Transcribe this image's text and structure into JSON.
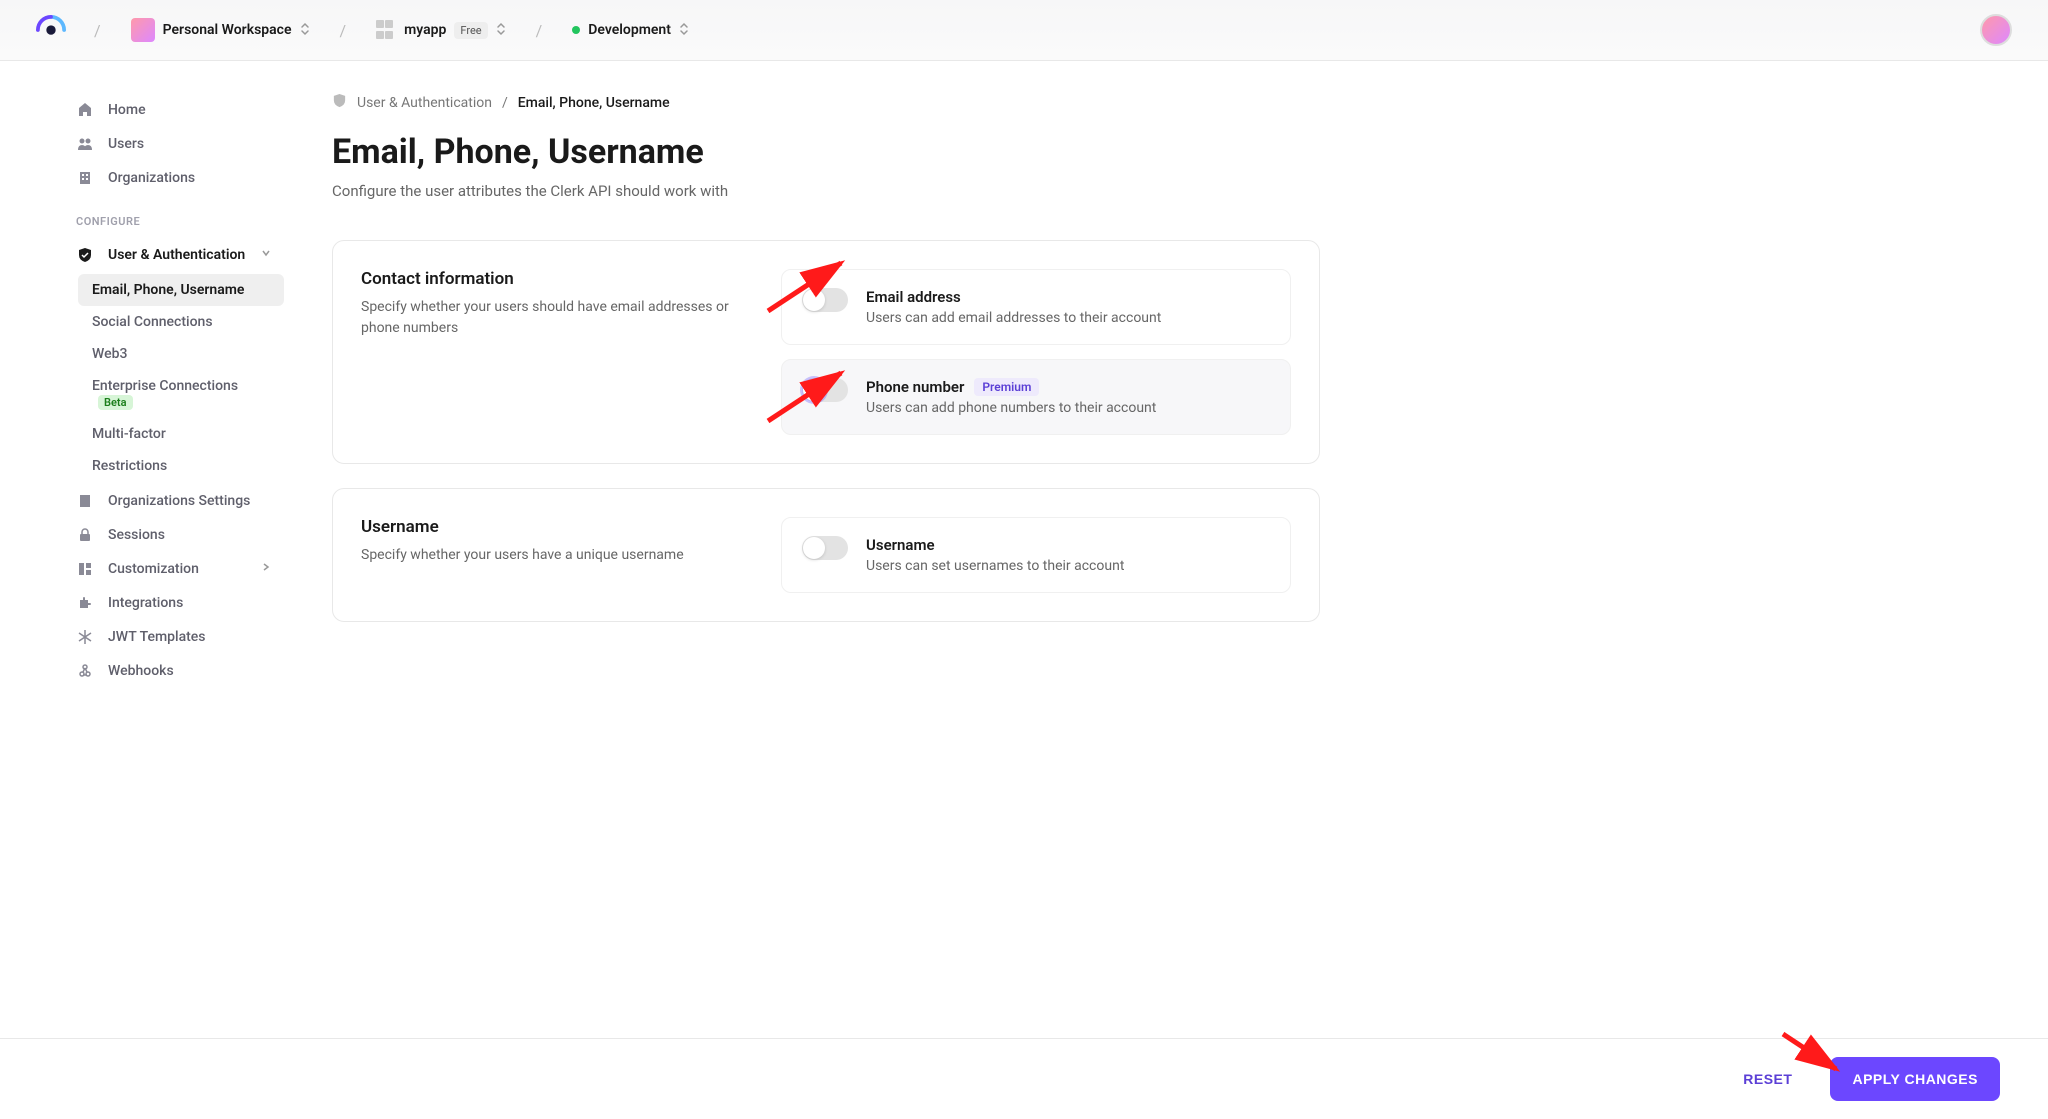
{
  "header": {
    "workspace": "Personal Workspace",
    "app": "myapp",
    "app_badge": "Free",
    "env": "Development"
  },
  "sidebar": {
    "top": [
      {
        "label": "Home"
      },
      {
        "label": "Users"
      },
      {
        "label": "Organizations"
      }
    ],
    "configure_label": "CONFIGURE",
    "ua_label": "User & Authentication",
    "ua_sub": [
      {
        "label": "Email, Phone, Username"
      },
      {
        "label": "Social Connections"
      },
      {
        "label": "Web3"
      },
      {
        "label": "Enterprise Connections",
        "badge": "Beta"
      },
      {
        "label": "Multi-factor"
      },
      {
        "label": "Restrictions"
      }
    ],
    "rest": [
      {
        "label": "Organizations Settings"
      },
      {
        "label": "Sessions"
      },
      {
        "label": "Customization",
        "chevron": true
      },
      {
        "label": "Integrations"
      },
      {
        "label": "JWT Templates"
      },
      {
        "label": "Webhooks"
      }
    ]
  },
  "breadcrumb": {
    "parent": "User & Authentication",
    "current": "Email, Phone, Username"
  },
  "page": {
    "title": "Email, Phone, Username",
    "subtitle": "Configure the user attributes the Clerk API should work with"
  },
  "sections": {
    "contact": {
      "title": "Contact information",
      "desc": "Specify whether your users should have email addresses or phone numbers",
      "options": [
        {
          "title": "Email address",
          "desc": "Users can add email addresses to their account"
        },
        {
          "title": "Phone number",
          "desc": "Users can add phone numbers to their account",
          "premium": "Premium"
        }
      ]
    },
    "username": {
      "title": "Username",
      "desc": "Specify whether your users have a unique username",
      "options": [
        {
          "title": "Username",
          "desc": "Users can set usernames to their account"
        }
      ]
    }
  },
  "footer": {
    "reset": "RESET",
    "apply": "APPLY CHANGES"
  }
}
